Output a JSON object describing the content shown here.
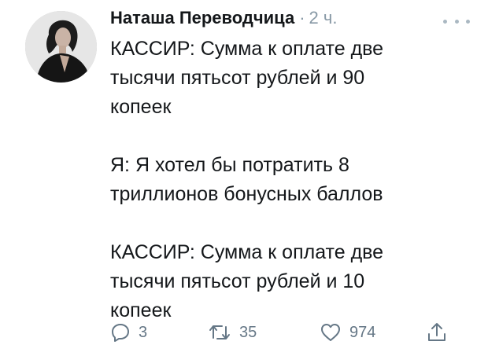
{
  "tweet": {
    "author": "Наташа Переводчица",
    "separator": "·",
    "time": "2 ч.",
    "paragraphs": [
      "КАССИР: Сумма к оплате две\nтысячи пятьсот рублей и 90\nкопеек",
      "Я: Я хотел бы потратить 8\nтриллионов бонусных баллов",
      "КАССИР: Сумма к оплате две\nтысячи пятьсот рублей и 10\nкопеек"
    ],
    "actions": {
      "reply_icon": "reply-icon",
      "reply_count": "3",
      "retweet_icon": "retweet-icon",
      "retweet_count": "35",
      "like_icon": "heart-icon",
      "like_count": "974",
      "share_icon": "share-icon"
    },
    "menu_icon": "more-icon"
  },
  "colors": {
    "text": "#14171a",
    "secondary": "#657786",
    "muted": "#8899a6"
  }
}
